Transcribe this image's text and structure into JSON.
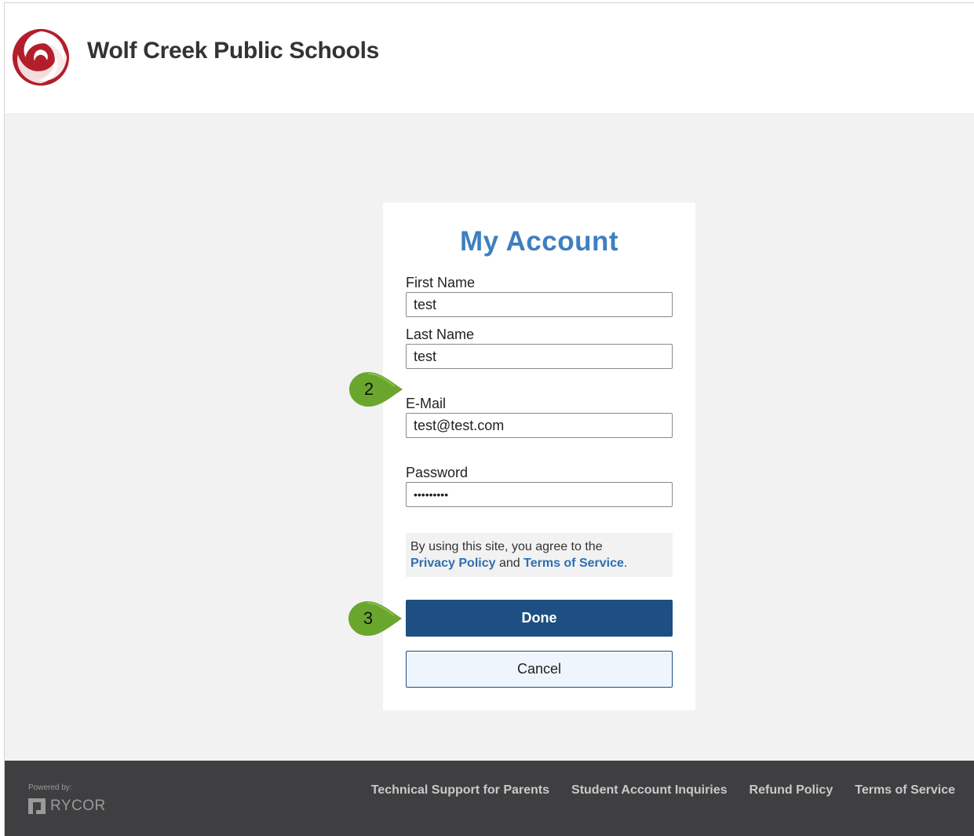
{
  "header": {
    "school_name": "Wolf Creek Public Schools",
    "logo_icon": "swirl-logo-icon",
    "brand_color": "#b31e2b"
  },
  "form": {
    "title": "My Account",
    "first_name": {
      "label": "First Name",
      "value": "test"
    },
    "last_name": {
      "label": "Last Name",
      "value": "test"
    },
    "email": {
      "label": "E-Mail",
      "value": "test@test.com"
    },
    "password": {
      "label": "Password",
      "value": "•••••••••"
    },
    "terms": {
      "prefix": "By using this site, you agree to the",
      "privacy_link": "Privacy Policy",
      "and": "and",
      "terms_link": "Terms of Service",
      "suffix": "."
    },
    "done_label": "Done",
    "cancel_label": "Cancel",
    "title_color": "#3e7fbf",
    "done_color": "#1d4f82"
  },
  "callouts": {
    "step_2": "2",
    "step_3": "3",
    "color": "#6aa62e"
  },
  "footer": {
    "powered_by": "Powered by:",
    "brand": "RYCOR",
    "links": [
      "Technical Support for Parents",
      "Student Account Inquiries",
      "Refund Policy",
      "Terms of Service"
    ]
  }
}
